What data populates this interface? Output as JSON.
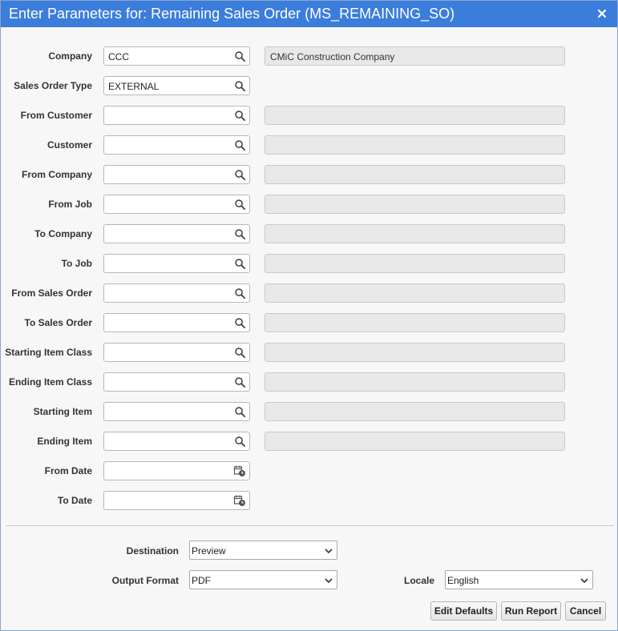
{
  "dialog": {
    "title": "Enter Parameters for: Remaining Sales Order (MS_REMAINING_SO)",
    "close_icon": "close-icon"
  },
  "params": [
    {
      "label": "Company",
      "value": "CCC",
      "icon": "search-icon",
      "description": "CMiC Construction Company"
    },
    {
      "label": "Sales Order Type",
      "value": "EXTERNAL",
      "icon": "search-icon"
    },
    {
      "label": "From Customer",
      "value": "",
      "icon": "search-icon",
      "description": ""
    },
    {
      "label": "Customer",
      "value": "",
      "icon": "search-icon",
      "description": ""
    },
    {
      "label": "From Company",
      "value": "",
      "icon": "search-icon",
      "description": ""
    },
    {
      "label": "From Job",
      "value": "",
      "icon": "search-icon",
      "description": ""
    },
    {
      "label": "To Company",
      "value": "",
      "icon": "search-icon",
      "description": ""
    },
    {
      "label": "To Job",
      "value": "",
      "icon": "search-icon",
      "description": ""
    },
    {
      "label": "From Sales Order",
      "value": "",
      "icon": "search-icon",
      "description": ""
    },
    {
      "label": "To Sales Order",
      "value": "",
      "icon": "search-icon",
      "description": ""
    },
    {
      "label": "Starting Item Class",
      "value": "",
      "icon": "search-icon",
      "description": ""
    },
    {
      "label": "Ending Item Class",
      "value": "",
      "icon": "search-icon",
      "description": ""
    },
    {
      "label": "Starting Item",
      "value": "",
      "icon": "search-icon",
      "description": ""
    },
    {
      "label": "Ending Item",
      "value": "",
      "icon": "search-icon",
      "description": ""
    },
    {
      "label": "From Date",
      "value": "",
      "icon": "calendar-icon"
    },
    {
      "label": "To Date",
      "value": "",
      "icon": "calendar-icon"
    }
  ],
  "output": {
    "destination_label": "Destination",
    "destination_value": "Preview",
    "format_label": "Output Format",
    "format_value": "PDF",
    "locale_label": "Locale",
    "locale_value": "English"
  },
  "buttons": {
    "edit_defaults": "Edit Defaults",
    "run_report": "Run Report",
    "cancel": "Cancel"
  },
  "colors": {
    "titlebar": "#3b7ddb",
    "background": "#f7f7f7",
    "readonly_field": "#e8e8e8"
  }
}
